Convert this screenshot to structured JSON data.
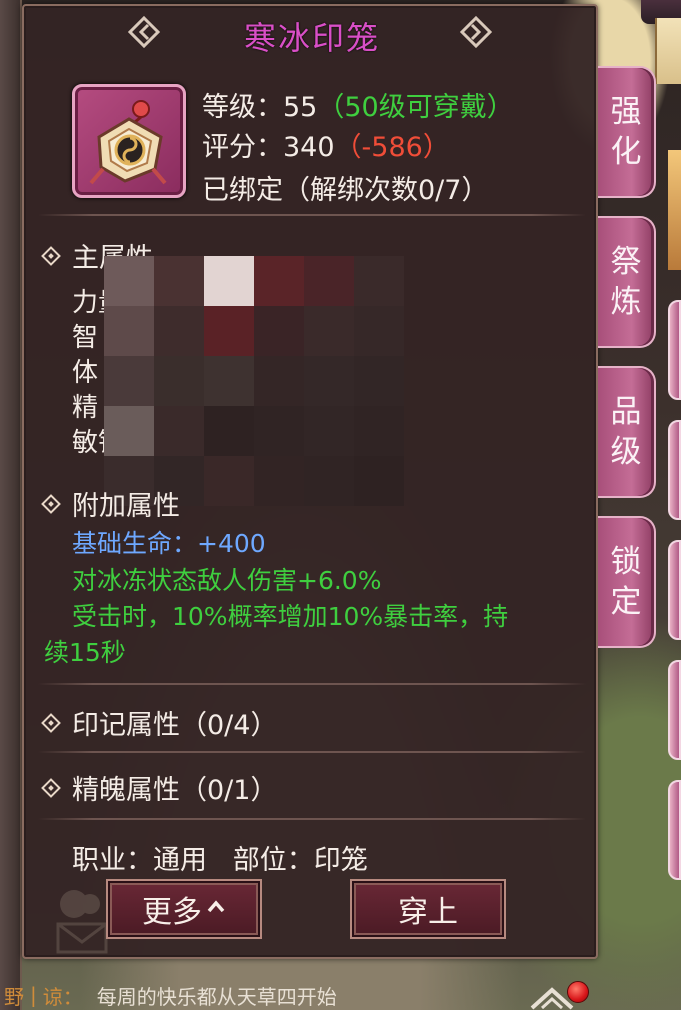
{
  "item": {
    "name": "寒冰印笼",
    "level_label": "等级：",
    "level_value": "55",
    "level_req": "（50级可穿戴）",
    "score_label": "评分：",
    "score_value": "340",
    "score_delta": "（-586）",
    "bound_text": "已绑定（解绑次数0/7）"
  },
  "main_attrs": {
    "header": "主属性",
    "lines": [
      "力量",
      "智",
      "体",
      "精",
      "敏锐"
    ]
  },
  "addon_attrs": {
    "header": "附加属性",
    "base_hp": "基础生命：+400",
    "frozen_dmg": "对冰冻状态敌人伤害+6.0%",
    "on_hit": "受击时，10%概率增加10%暴击率，持",
    "on_hit_cont": "续15秒"
  },
  "mark_attrs": {
    "header": "印记属性（0/4）"
  },
  "soul_attrs": {
    "header": "精魄属性（0/1）"
  },
  "job_line": "职业：通用   部位：印笼",
  "buttons": {
    "more": "更多",
    "wear": "穿上"
  },
  "side_tabs": {
    "strengthen": [
      "强",
      "化"
    ],
    "refine": [
      "祭",
      "炼"
    ],
    "grade": [
      "品",
      "级"
    ],
    "lock": [
      "锁",
      "定"
    ]
  },
  "chat": {
    "channel": "野",
    "name": "谅：",
    "message": "每周的快乐都从天草四开始"
  },
  "colors": {
    "title": "#d94fc7",
    "green": "#3fcf3f",
    "red": "#f04d38",
    "blue": "#6ea8ff"
  }
}
